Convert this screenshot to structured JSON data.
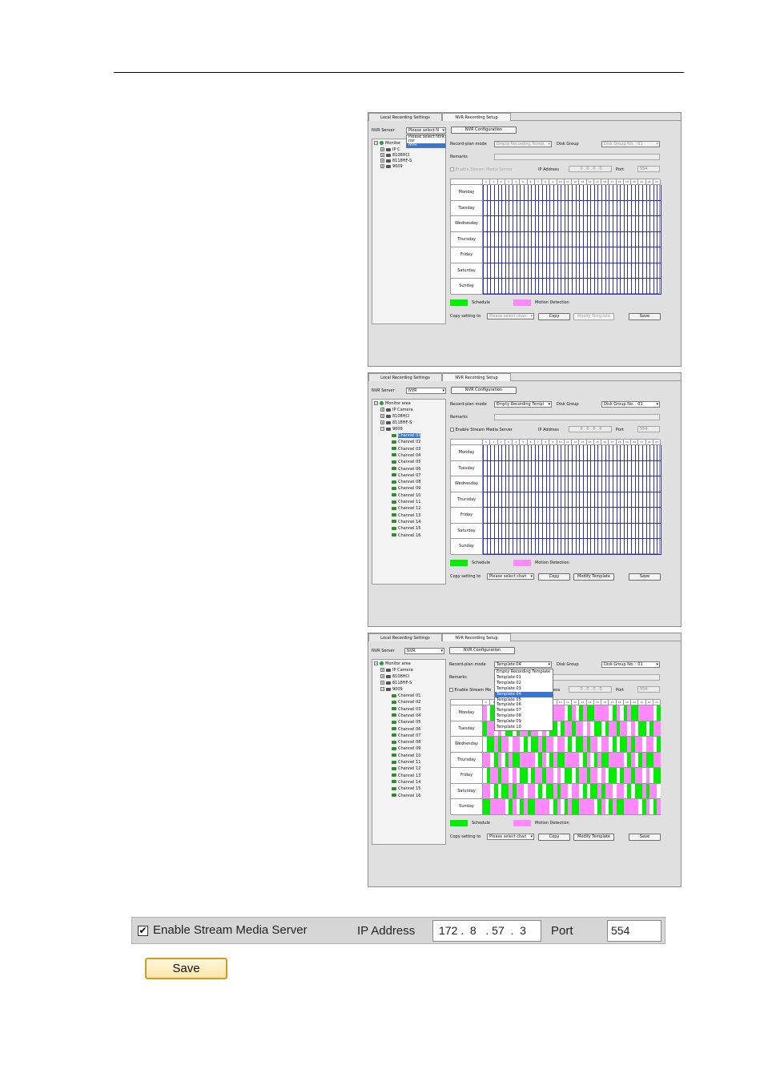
{
  "common": {
    "tab_local": "Local Recording Settings",
    "tab_nvr": "NVR Recording Setup",
    "nvr_server_label": "NVR Server",
    "nvr_config_button": "NVR Configuration",
    "record_plan_label": "Record-plan mode",
    "disk_group_label": "Disk Group",
    "disk_group_value": "Disk Group No. : 01",
    "remarks_label": "Remarks",
    "enable_stream_label": "Enable Stream Media Server",
    "ip_label": "IP Address",
    "ip_value": "0 . 0 . 0 . 0",
    "port_label": "Port",
    "port_value": "554",
    "days": [
      "Monday",
      "Tuesday",
      "Wednesday",
      "Thursday",
      "Friday",
      "Saturday",
      "Sunday"
    ],
    "hours": [
      "0",
      "1",
      "2",
      "3",
      "4",
      "5",
      "6",
      "7",
      "8",
      "9",
      "10",
      "11",
      "12",
      "13",
      "14",
      "15",
      "16",
      "17",
      "18",
      "19",
      "20",
      "21",
      "22",
      "23"
    ],
    "legend_schedule": "Schedule",
    "legend_motion": "Motion Detection",
    "copy_label": "Copy setting to",
    "copy_placeholder": "Please select chan",
    "copy_button": "Copy",
    "modify_button": "Modify Template",
    "save_button": "Save",
    "colors": {
      "schedule": "#00ee00",
      "motion": "#ff88ff",
      "grid_line": "#3030c8",
      "highlight": "#3875d7"
    }
  },
  "panel1": {
    "nvr_server_value": "Please select N",
    "plan_value": "Empty Recording Templ",
    "dropdown": [
      "Please select NVR",
      "nvr",
      "NVR"
    ],
    "dropdown_selected": 2,
    "tree_root": "Monitor",
    "tree_items": [
      "IP C",
      "8108HCI",
      "8118HF-S",
      "9009"
    ]
  },
  "panel2": {
    "nvr_server_value": "NVR",
    "plan_value": "Empty Recording Templ",
    "tree_root": "Monitor area",
    "tree_items": [
      "IP Camera",
      "8108HCI",
      "8118HF-S",
      "9009"
    ],
    "channels": [
      "Channel 01",
      "Channel 02",
      "Channel 03",
      "Channel 04",
      "Channel 05",
      "Channel 06",
      "Channel 07",
      "Channel 08",
      "Channel 09",
      "Channel 10",
      "Channel 11",
      "Channel 12",
      "Channel 13",
      "Channel 14",
      "Channel 15",
      "Channel 16"
    ],
    "selected_channel": 0
  },
  "panel3": {
    "nvr_server_value": "NVR",
    "plan_value": "Template 04",
    "tree_root": "Monitor area",
    "tree_items": [
      "IP Camera",
      "8108HCI",
      "8118HF-S",
      "9009"
    ],
    "channels": [
      "Channel 01",
      "Channel 02",
      "Channel 03",
      "Channel 04",
      "Channel 05",
      "Channel 06",
      "Channel 07",
      "Channel 08",
      "Channel 09",
      "Channel 10",
      "Channel 11",
      "Channel 12",
      "Channel 13",
      "Channel 14",
      "Channel 15",
      "Channel 16"
    ],
    "enable_stream_partial": "Enable Stream Me",
    "ip_partial_label": "ress",
    "template_options": [
      "Empty Recording Template",
      "Template 01",
      "Template 02",
      "Template 03",
      "Template 04",
      "Template 05",
      "Template 06",
      "Template 07",
      "Template 08",
      "Template 09",
      "Template 10"
    ],
    "template_selected": 4
  },
  "bottom_bar": {
    "enable_checked": true,
    "check_mark": "✔",
    "enable_label": "Enable Stream Media Server",
    "ip_label": "IP Address",
    "ip_value": "172 .  8   . 57  .  3",
    "port_label": "Port",
    "port_value": "554"
  },
  "bottom_save": "Save"
}
